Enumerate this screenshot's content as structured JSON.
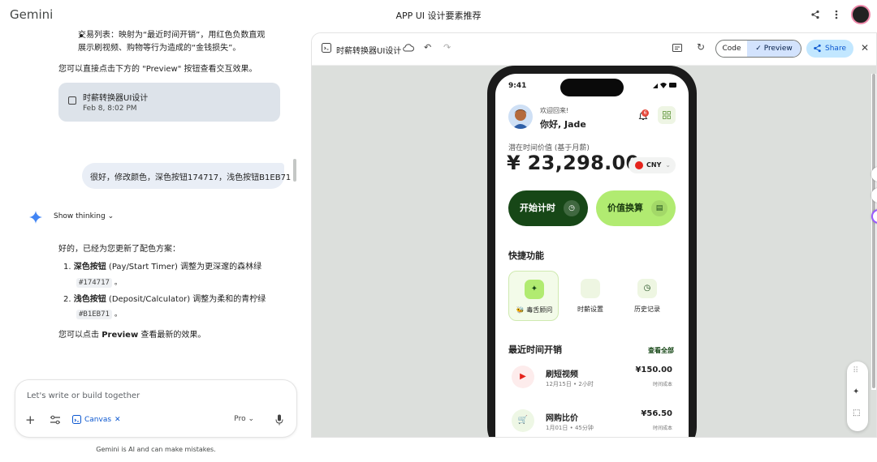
{
  "app": {
    "brand": "Gemini",
    "doc_title": "APP UI 设计要素推荐"
  },
  "chat": {
    "bullet_line1": "交易列表：映射为“最近时间开销”，用红色负数直观",
    "bullet_line2": "展示刷视频、购物等行为造成的“金钱损失”。",
    "preview_hint": "您可以直接点击下方的 \"Preview\" 按钮查看交互效果。",
    "canvas_card": {
      "title": "时薪转换器UI设计",
      "date": "Feb 8, 8:02 PM"
    },
    "user_message": "很好，修改颜色，深色按钮174717，浅色按钮B1EB71",
    "show_thinking": "Show thinking",
    "reply_intro": "好的，已经为您更新了配色方案：",
    "list": [
      {
        "num": "1.",
        "bold": "深色按钮",
        "text": " (Pay/Start Timer) 调整为更深邃的森林绿",
        "code": "#174717",
        "tail": "。"
      },
      {
        "num": "2.",
        "bold": "浅色按钮",
        "text": " (Deposit/Calculator) 调整为柔和的青柠绿",
        "code": "#B1EB71",
        "tail": "。"
      }
    ],
    "closing_pre": "您可以点击 ",
    "closing_bold": "Preview",
    "closing_post": " 查看最新的效果。"
  },
  "input": {
    "placeholder": "Let's write or build together",
    "canvas_chip": "Canvas",
    "model": "Pro",
    "disclaimer": "Gemini is AI and can make mistakes."
  },
  "panel": {
    "title": "时薪转换器UI设计",
    "code_label": "Code",
    "preview_label": "Preview",
    "share_label": "Share"
  },
  "phone": {
    "time": "9:41",
    "greeting": "欢迎回来!",
    "name": "你好, Jade",
    "badge": "6",
    "value_label": "潜在时间价值 (基于月薪)",
    "amount": "¥ 23,298.00",
    "currency": "CNY",
    "start_button": "开始计时",
    "convert_button": "价值换算",
    "quick_title": "快捷功能",
    "quick_actions": [
      {
        "label": "🐝 毒舌顾问",
        "icon": "sparkle-icon"
      },
      {
        "label": "时薪设置",
        "icon": "settings-icon"
      },
      {
        "label": "历史记录",
        "icon": "history-icon"
      }
    ],
    "recent_title": "最近时间开销",
    "view_all": "查看全部",
    "transactions": [
      {
        "name": "刷短视频",
        "meta": "12月15日 • 2小时",
        "amount": "¥150.00",
        "label": "时间成本",
        "icon": "youtube-icon"
      },
      {
        "name": "网购比价",
        "meta": "1月01日 • 45分钟",
        "amount": "¥56.50",
        "label": "时间成本",
        "icon": "cart-icon"
      }
    ]
  },
  "colors": {
    "dark_button": "#174717",
    "light_button": "#B1EB71",
    "accent": "#0b57d0"
  }
}
